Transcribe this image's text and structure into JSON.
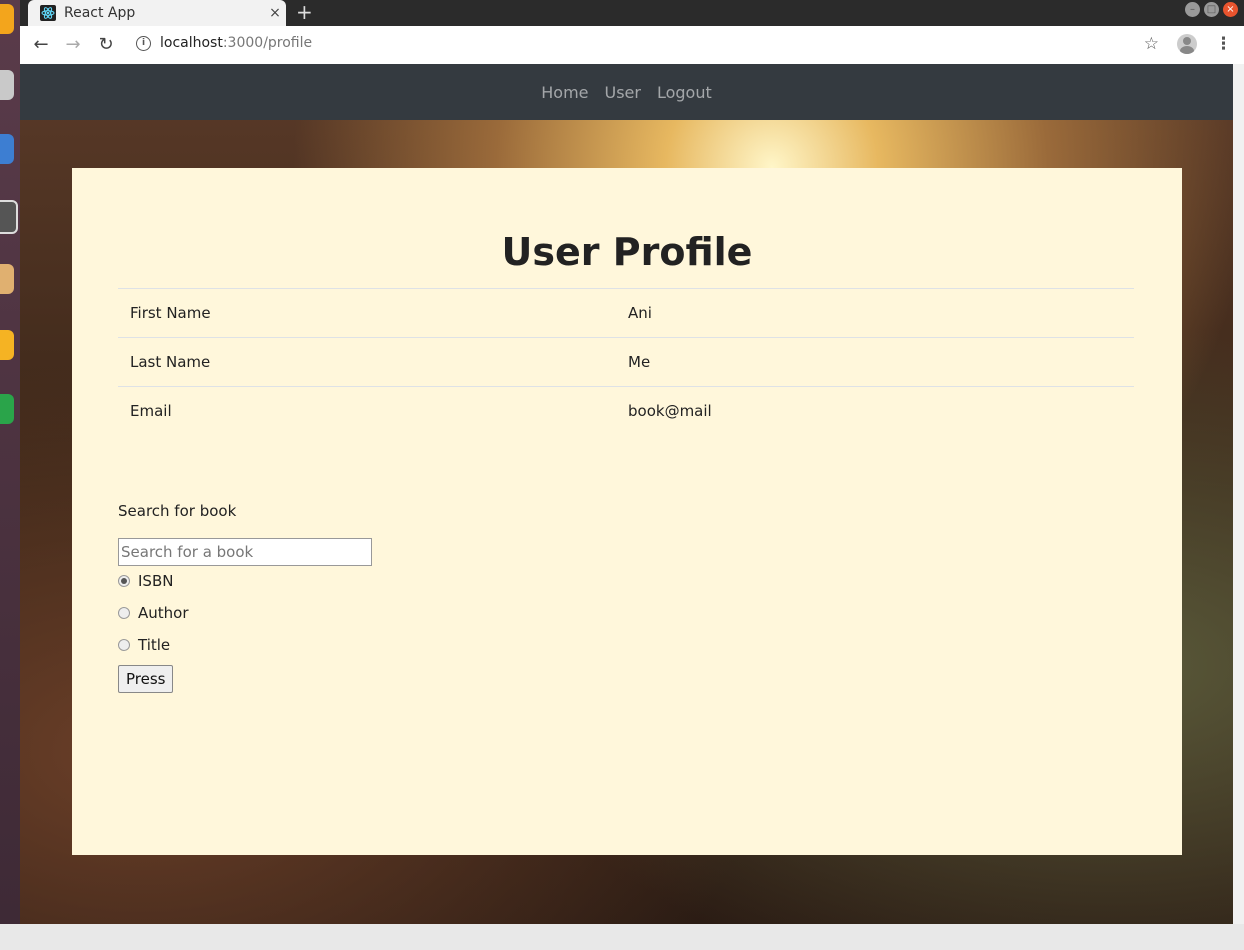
{
  "browser": {
    "tab_title": "React App",
    "tab_close": "×",
    "new_tab": "+",
    "url_host": "localhost",
    "url_path": ":3000/profile"
  },
  "nav": {
    "links": [
      "Home",
      "User",
      "Logout"
    ]
  },
  "profile": {
    "title": "User Profile",
    "rows": [
      {
        "label": "First Name",
        "value": "Ani"
      },
      {
        "label": "Last Name",
        "value": "Me"
      },
      {
        "label": "Email",
        "value": "book@mail"
      }
    ]
  },
  "search": {
    "label": "Search for book",
    "placeholder": "Search for a book",
    "value": "",
    "options": [
      {
        "label": "ISBN",
        "checked": true
      },
      {
        "label": "Author",
        "checked": false
      },
      {
        "label": "Title",
        "checked": false
      }
    ],
    "button": "Press"
  },
  "colors": {
    "navbar": "#343a40",
    "panel": "#fff7db"
  }
}
